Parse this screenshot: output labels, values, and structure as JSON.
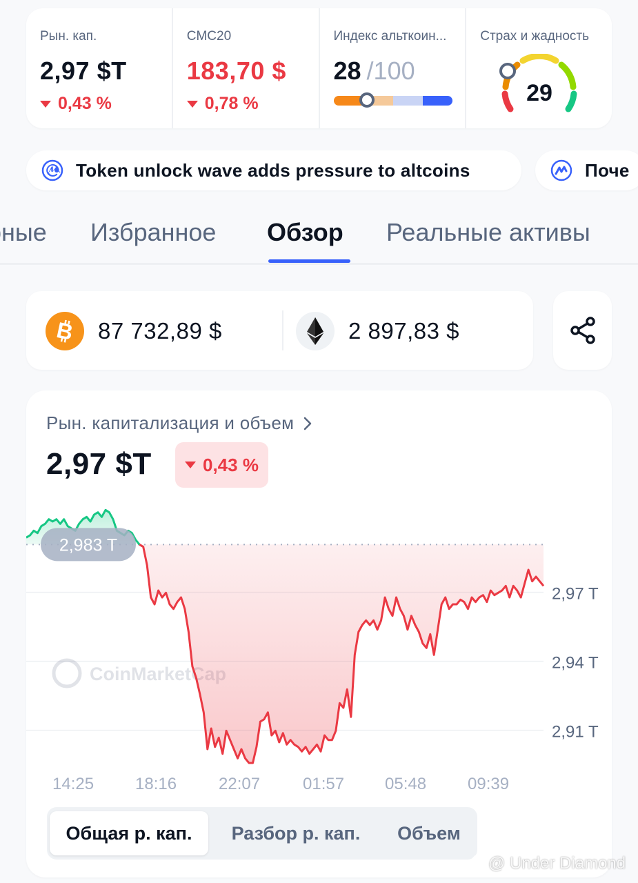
{
  "stats": {
    "market_cap": {
      "label": "Рын. кап.",
      "value": "2,97 $T",
      "change": "0,43 %"
    },
    "cmc20": {
      "label": "CMC20",
      "value": "183,70 $",
      "change": "0,78 %"
    },
    "altcoin_index": {
      "label": "Индекс альткоин...",
      "value": "28",
      "max": "/100",
      "level": 0.28
    },
    "fear_greed": {
      "label": "Страх и жадность",
      "value": "29",
      "level": 0.29
    }
  },
  "news": [
    {
      "text": "Token unlock wave adds pressure to altcoins"
    },
    {
      "text": "Поче"
    }
  ],
  "tabs": [
    "рные",
    "Избранное",
    "Обзор",
    "Реальные активы"
  ],
  "active_tab": "Обзор",
  "prices": {
    "btc": "87 732,89 $",
    "eth": "2 897,83 $"
  },
  "chart": {
    "title": "Рын. капитализация и объем",
    "value": "2,97 $T",
    "change": "0,43 %",
    "baseline_label": "2,983 T",
    "watermark": "CoinMarketCap",
    "segments": [
      "Общая р. кап.",
      "Разбор р. кап.",
      "Объем"
    ]
  },
  "chart_data": {
    "type": "line",
    "ylabel": "",
    "xlabel": "",
    "y_tick_labels": [
      "2,97 T",
      "2,94 T",
      "2,91 T"
    ],
    "y_ticks": [
      2.97,
      2.94,
      2.91
    ],
    "x_tick_labels": [
      "14:25",
      "18:16",
      "22:07",
      "01:57",
      "05:48",
      "09:39"
    ],
    "baseline": 2.983,
    "ylim": [
      2.894,
      2.999
    ],
    "series": [
      {
        "values": [
          2.986,
          2.987,
          2.989,
          2.988,
          2.991,
          2.992,
          2.994,
          2.993,
          2.994,
          2.992,
          2.994,
          2.991,
          2.99,
          2.989,
          2.992,
          2.994,
          2.995,
          2.993,
          2.996,
          2.997,
          2.995,
          2.998,
          2.997,
          2.994,
          2.989,
          2.988,
          2.987,
          2.989,
          2.988,
          2.985,
          2.983,
          2.982,
          2.974,
          2.96,
          2.957,
          2.963,
          2.96,
          2.962,
          2.957,
          2.955,
          2.958,
          2.96,
          2.955,
          2.945,
          2.93,
          2.925,
          2.918,
          2.91,
          2.894,
          2.903,
          2.895,
          2.899,
          2.892,
          2.902,
          2.898,
          2.894,
          2.89,
          2.894,
          2.89,
          2.888,
          2.888,
          2.895,
          2.906,
          2.907,
          2.91,
          2.9,
          2.902,
          2.897,
          2.901,
          2.896,
          2.898,
          2.896,
          2.895,
          2.893,
          2.895,
          2.892,
          2.894,
          2.896,
          2.893,
          2.9,
          2.898,
          2.898,
          2.902,
          2.914,
          2.912,
          2.92,
          2.908,
          2.935,
          2.945,
          2.948,
          2.95,
          2.948,
          2.95,
          2.946,
          2.95,
          2.96,
          2.955,
          2.952,
          2.96,
          2.955,
          2.952,
          2.946,
          2.952,
          2.948,
          2.945,
          2.94,
          2.938,
          2.944,
          2.935,
          2.946,
          2.957,
          2.96,
          2.955,
          2.957,
          2.957,
          2.959,
          2.958,
          2.955,
          2.96,
          2.958,
          2.96,
          2.961,
          2.958,
          2.963,
          2.961,
          2.962,
          2.963,
          2.965,
          2.96,
          2.965,
          2.963,
          2.96,
          2.966,
          2.972,
          2.967,
          2.969,
          2.967,
          2.965
        ]
      }
    ]
  }
}
